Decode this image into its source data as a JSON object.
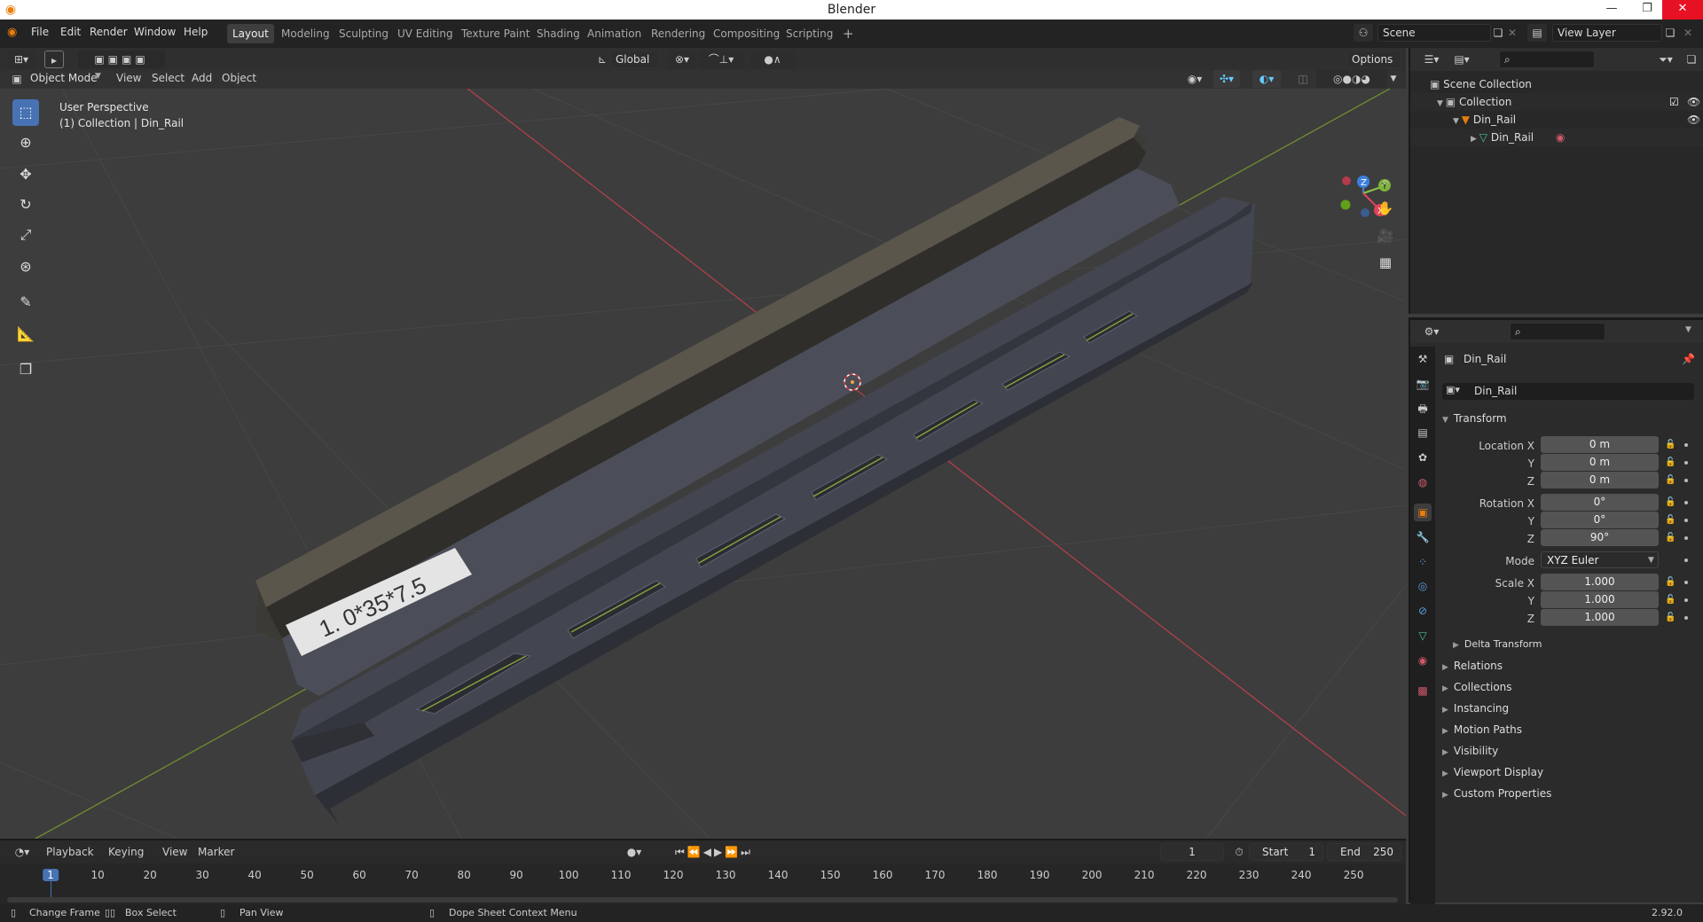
{
  "window": {
    "title": "Blender",
    "minimize": "—",
    "restore": "❐",
    "close": "✕"
  },
  "menu": [
    "File",
    "Edit",
    "Render",
    "Window",
    "Help"
  ],
  "workspaces": [
    {
      "label": "Layout",
      "active": true
    },
    {
      "label": "Modeling"
    },
    {
      "label": "Sculpting"
    },
    {
      "label": "UV Editing"
    },
    {
      "label": "Texture Paint"
    },
    {
      "label": "Shading"
    },
    {
      "label": "Animation"
    },
    {
      "label": "Rendering"
    },
    {
      "label": "Compositing"
    },
    {
      "label": "Scripting"
    }
  ],
  "add_workspace": "+",
  "scene": {
    "label": "Scene",
    "view_layer": "View Layer"
  },
  "viewport_header": {
    "transform_orientation": "Global",
    "options": "Options",
    "mode": "Object Mode",
    "menus": [
      "View",
      "Select",
      "Add",
      "Object"
    ]
  },
  "viewport_overlay": {
    "line1": "User Perspective",
    "line2": "(1) Collection | Din_Rail"
  },
  "rail_label": "1. 0*35*7.5",
  "gizmo": {
    "x": "X",
    "y": "Y",
    "z": "Z"
  },
  "outliner": {
    "scene_collection": "Scene Collection",
    "collection": "Collection",
    "object": "Din_Rail",
    "mesh": "Din_Rail"
  },
  "properties": {
    "header_object": "Din_Rail",
    "name_field": "Din_Rail",
    "transform_title": "Transform",
    "location_label": "Location X",
    "rotation_label": "Rotation X",
    "scale_label": "Scale X",
    "y_label": "Y",
    "z_label": "Z",
    "mode_label": "Mode",
    "location": [
      "0 m",
      "0 m",
      "0 m"
    ],
    "rotation": [
      "0°",
      "0°",
      "90°"
    ],
    "rotation_mode": "XYZ Euler",
    "scale": [
      "1.000",
      "1.000",
      "1.000"
    ],
    "delta_transform": "Delta Transform",
    "sections": [
      "Relations",
      "Collections",
      "Instancing",
      "Motion Paths",
      "Visibility",
      "Viewport Display",
      "Custom Properties"
    ]
  },
  "timeline": {
    "menus": [
      "Playback",
      "Keying",
      "View",
      "Marker"
    ],
    "current_frame": "1",
    "start_label": "Start",
    "start": "1",
    "end_label": "End",
    "end": "250",
    "ticks": [
      "1",
      "10",
      "20",
      "30",
      "40",
      "50",
      "60",
      "70",
      "80",
      "90",
      "100",
      "110",
      "120",
      "130",
      "140",
      "150",
      "160",
      "170",
      "180",
      "190",
      "200",
      "210",
      "220",
      "230",
      "240",
      "250"
    ]
  },
  "statusbar": {
    "change_frame": "Change Frame",
    "box_select": "Box Select",
    "pan_view": "Pan View",
    "context_menu": "Dope Sheet Context Menu",
    "version": "2.92.0"
  },
  "colors": {
    "accent": "#4772b3",
    "x_axis": "#c0404c",
    "y_axis": "#7ea03a",
    "z_axis": "#3b80e0",
    "object_orange": "#e87d0d"
  }
}
